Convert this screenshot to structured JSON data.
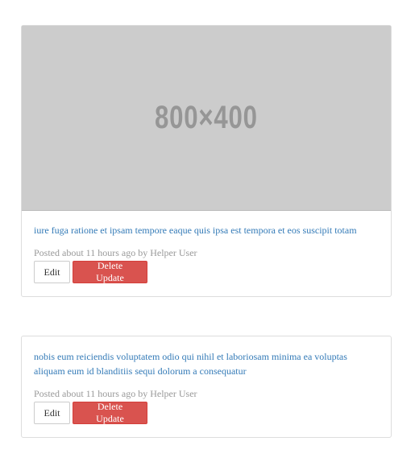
{
  "updates": [
    {
      "image_placeholder_text": "800×400",
      "content": "iure fuga ratione et ipsam tempore eaque quis ipsa est tempora et eos suscipit totam",
      "meta": "Posted about 11 hours ago by Helper User",
      "edit_label": "Edit",
      "delete_label": "Delete Update"
    },
    {
      "content": "nobis eum reiciendis voluptatem odio qui nihil et laboriosam minima ea voluptas aliquam eum id blanditiis sequi dolorum a consequatur",
      "meta": "Posted about 11 hours ago by Helper User",
      "edit_label": "Edit",
      "delete_label": "Delete Update"
    }
  ],
  "colors": {
    "link": "#337ab7",
    "meta": "#999999",
    "danger": "#d9534f",
    "placeholder_bg": "#cccccc"
  }
}
